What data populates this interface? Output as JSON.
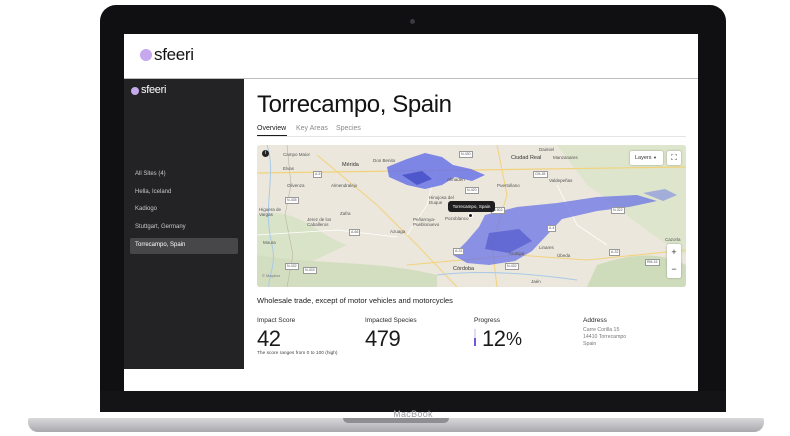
{
  "device": {
    "brand": "MacBook"
  },
  "app": {
    "name": "sfeeri",
    "brand_color": "#c6a8ef"
  },
  "sidebar": {
    "logo": "sfeeri",
    "heading": "All Sites (4)",
    "items": [
      {
        "label": "Hella, Iceland"
      },
      {
        "label": "Kadiogo"
      },
      {
        "label": "Stuttgart, Germany"
      },
      {
        "label": "Torrecampo, Spain",
        "active": true
      }
    ]
  },
  "main": {
    "title": "Torrecampo, Spain",
    "tabs": [
      {
        "label": "Overview",
        "active": true
      },
      {
        "label": "Key Areas",
        "active": false
      },
      {
        "label": "Species",
        "active": false
      }
    ],
    "map": {
      "layers_label": "Layers",
      "tooltip": "Torrecampo, Spain",
      "impact_color": "#6a73e6",
      "places": [
        "Campo Maior",
        "Elvas",
        "Mérida",
        "Don Benito",
        "Daimiel",
        "Manzanares",
        "Ciudad Real",
        "Valdepeñas",
        "Puertollano",
        "Olivenza",
        "Almendralejo",
        "Zafra",
        "Almadén",
        "Hinojosa del Duque",
        "Peñarroya-Pueblonuevo",
        "Pozoblanco",
        "Azuaga",
        "Jerez de los Caballeros",
        "Linares",
        "Úbeda",
        "Andújar",
        "Córdoba",
        "Moura",
        "Jaén",
        "Cazorla",
        "Higuera de Vargas"
      ],
      "road_labels": [
        "N-430",
        "A-5",
        "N-435",
        "A-66",
        "N-432",
        "N-502",
        "A-4",
        "N-420",
        "CM-45",
        "N-322",
        "A-32",
        "N-432",
        "RM-15",
        "A-31",
        "N-433"
      ],
      "attribution": "© Mapbox",
      "icons": [
        "info-icon",
        "chevron-down-icon",
        "fullscreen-icon",
        "zoom-in-icon",
        "zoom-out-icon",
        "map-pin-icon"
      ]
    },
    "sector": "Wholesale trade, except of motor vehicles and motorcycles",
    "stats": {
      "impact": {
        "label": "Impact Score",
        "value": "42",
        "note": "The score ranges from 0 to 100 (high)"
      },
      "species": {
        "label": "Impacted Species",
        "value": "479"
      },
      "progress": {
        "label": "Progress",
        "value": "12",
        "unit": "%",
        "fraction": 0.12
      },
      "address": {
        "label": "Address",
        "lines": [
          "Carre Corilla 15",
          "14410 Torrecampo",
          "Spain"
        ]
      }
    }
  }
}
